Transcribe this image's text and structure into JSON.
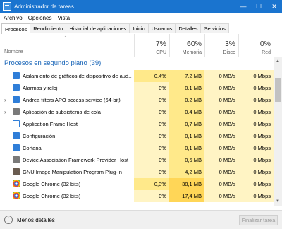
{
  "window": {
    "title": "Administrador de tareas",
    "minimize_icon": "minimize-icon",
    "maximize_icon": "maximize-icon",
    "close_icon": "close-icon"
  },
  "menu": {
    "items": [
      "Archivo",
      "Opciones",
      "Vista"
    ]
  },
  "tabs": [
    {
      "label": "Procesos",
      "active": true
    },
    {
      "label": "Rendimiento",
      "active": false
    },
    {
      "label": "Historial de aplicaciones",
      "active": false
    },
    {
      "label": "Inicio",
      "active": false
    },
    {
      "label": "Usuarios",
      "active": false
    },
    {
      "label": "Detalles",
      "active": false
    },
    {
      "label": "Servicios",
      "active": false
    }
  ],
  "header": {
    "name_label": "Nombre",
    "cpu": {
      "pct": "7%",
      "label": "CPU"
    },
    "mem": {
      "pct": "60%",
      "label": "Memoria"
    },
    "disk": {
      "pct": "3%",
      "label": "Disco"
    },
    "net": {
      "pct": "0%",
      "label": "Red"
    }
  },
  "group": {
    "label": "Procesos en segundo plano (39)"
  },
  "rows": [
    {
      "name": "Aislamiento de gráficos de dispositivo de aud...",
      "cpu": "0,4%",
      "mem": "7,2 MB",
      "disk": "0 MB/s",
      "net": "0 Mbps",
      "icon": "blue",
      "expand": false
    },
    {
      "name": "Alarmas y reloj",
      "cpu": "0%",
      "mem": "0,1 MB",
      "disk": "0 MB/s",
      "net": "0 Mbps",
      "icon": "blue",
      "expand": false
    },
    {
      "name": "Andrea filters APO access service (64-bit)",
      "cpu": "0%",
      "mem": "0,2 MB",
      "disk": "0 MB/s",
      "net": "0 Mbps",
      "icon": "blue",
      "expand": true
    },
    {
      "name": "Aplicación de subsistema de cola",
      "cpu": "0%",
      "mem": "0,4 MB",
      "disk": "0 MB/s",
      "net": "0 Mbps",
      "icon": "gray",
      "expand": true
    },
    {
      "name": "Application Frame Host",
      "cpu": "0%",
      "mem": "0,7 MB",
      "disk": "0 MB/s",
      "net": "0 Mbps",
      "icon": "frame",
      "expand": false
    },
    {
      "name": "Configuración",
      "cpu": "0%",
      "mem": "0,1 MB",
      "disk": "0 MB/s",
      "net": "0 Mbps",
      "icon": "blue",
      "expand": false
    },
    {
      "name": "Cortana",
      "cpu": "0%",
      "mem": "0,1 MB",
      "disk": "0 MB/s",
      "net": "0 Mbps",
      "icon": "blue",
      "expand": false
    },
    {
      "name": "Device Association Framework Provider Host",
      "cpu": "0%",
      "mem": "0,5 MB",
      "disk": "0 MB/s",
      "net": "0 Mbps",
      "icon": "gray",
      "expand": false
    },
    {
      "name": "GNU Image Manipulation Program Plug-In",
      "cpu": "0%",
      "mem": "4,2 MB",
      "disk": "0 MB/s",
      "net": "0 Mbps",
      "icon": "gimp",
      "expand": false
    },
    {
      "name": "Google Chrome (32 bits)",
      "cpu": "0,3%",
      "mem": "38,1 MB",
      "disk": "0 MB/s",
      "net": "0 Mbps",
      "icon": "chrome",
      "expand": false
    },
    {
      "name": "Google Chrome (32 bits)",
      "cpu": "0%",
      "mem": "17,4 MB",
      "disk": "0 MB/s",
      "net": "0 Mbps",
      "icon": "chrome",
      "expand": false
    }
  ],
  "footer": {
    "less_details": "Menos detalles",
    "end_task": "Finalizar tarea"
  },
  "colors": {
    "title_bar": "#1a74cf",
    "group_text": "#1a66b8",
    "cell_light": "#fff4c4",
    "cell_medium": "#ffe98a",
    "cell_strong": "#ffd657"
  }
}
